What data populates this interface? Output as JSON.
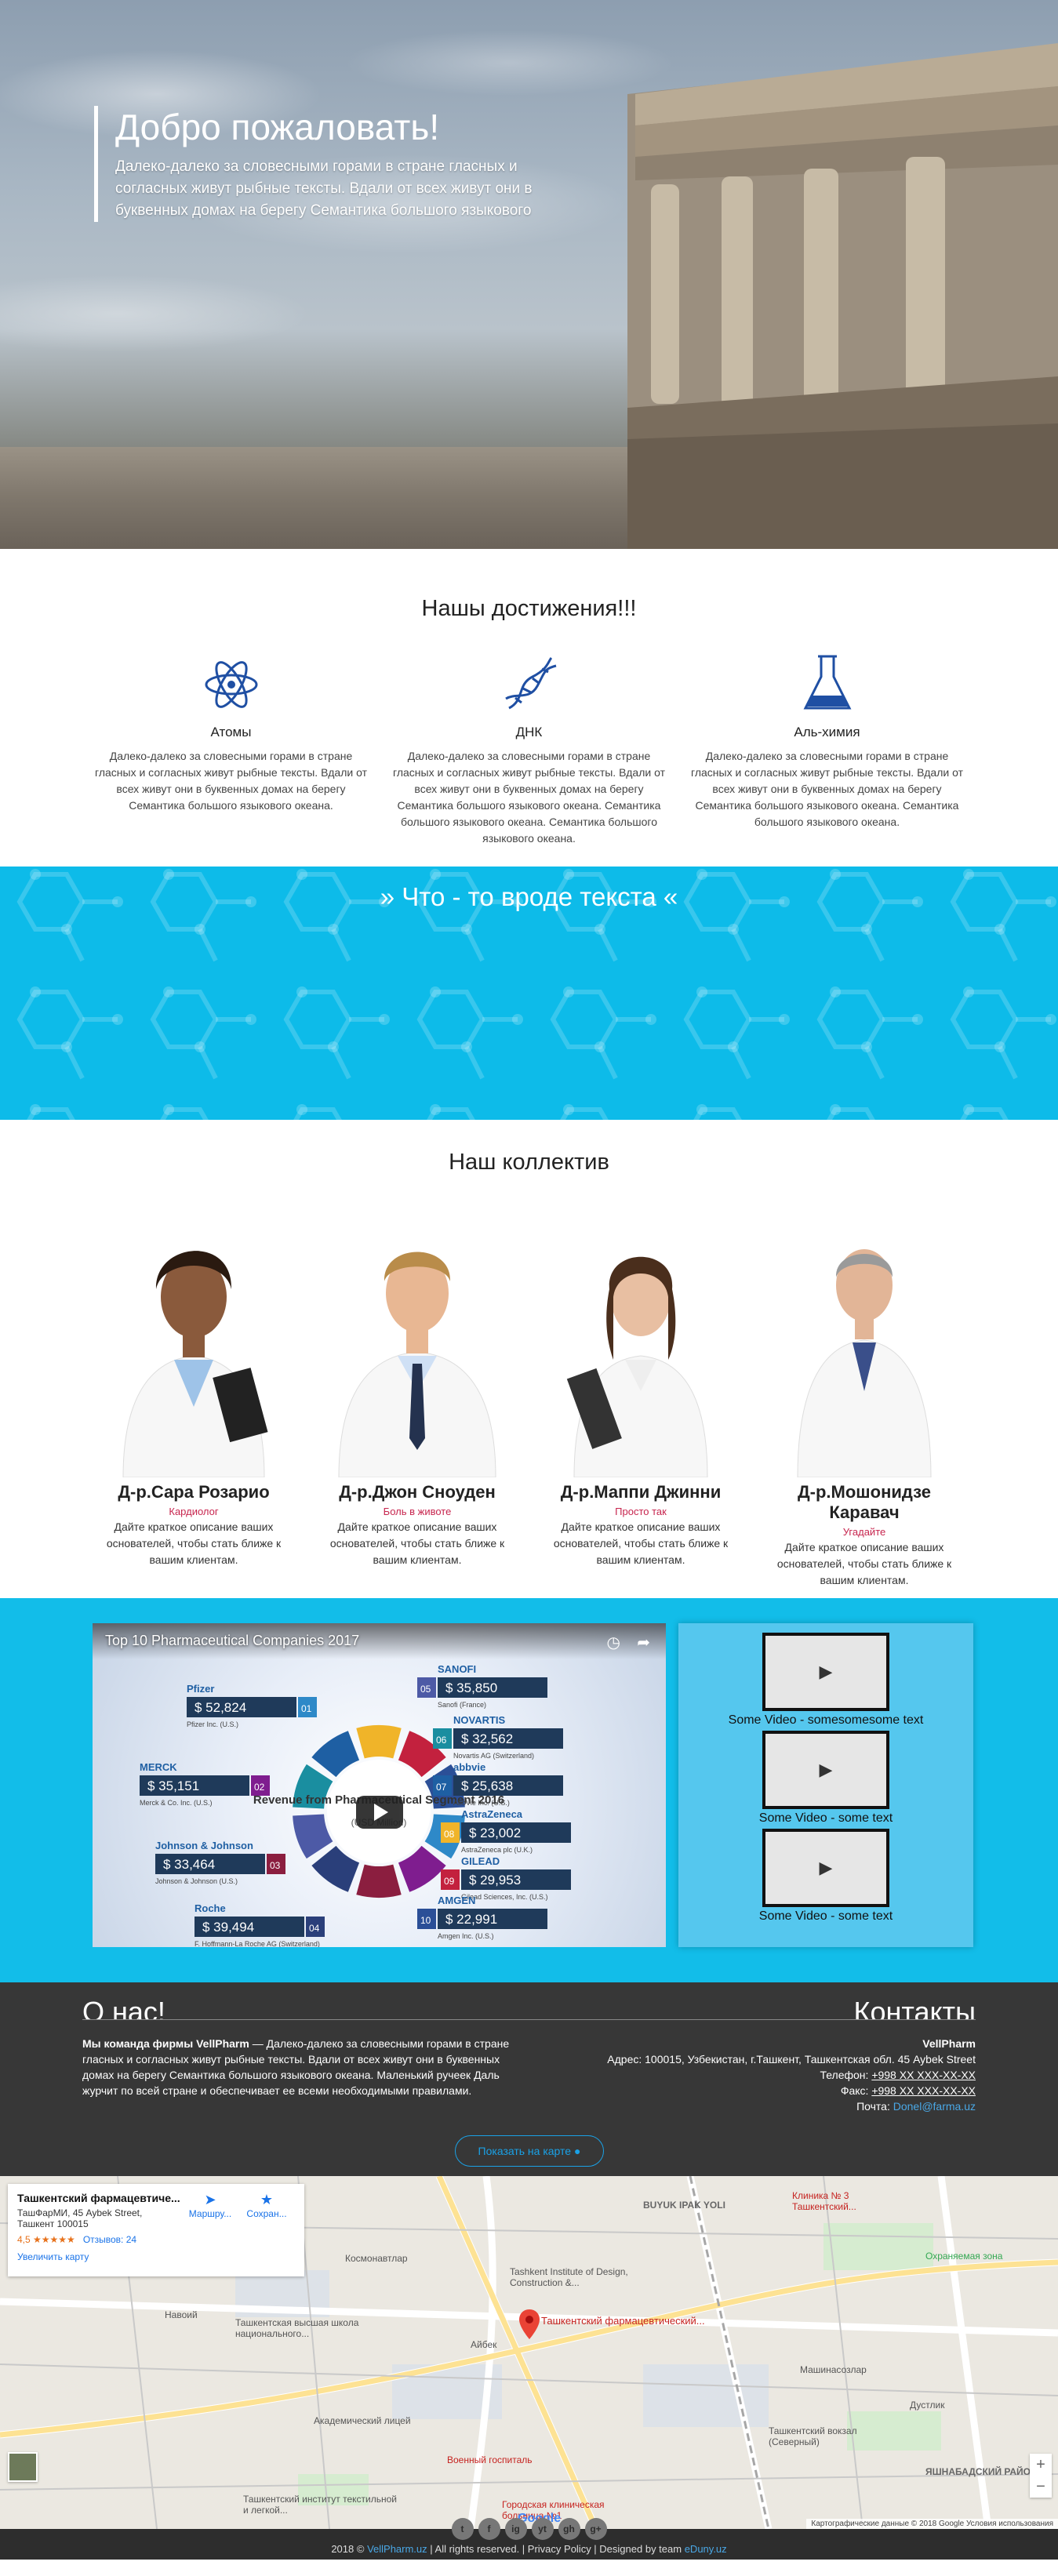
{
  "hero": {
    "title": "Добро пожаловать!",
    "text": "Далеко-далеко за словесными горами в стране гласных и согласных живут рыбные тексты. Вдали от всех живут они в буквенных домах на берегу Семантика большого языкового"
  },
  "achievements": {
    "title": "Нашы достижения!!!",
    "items": [
      {
        "icon": "atom-icon",
        "title": "Атомы",
        "text": "Далеко-далеко за словесными горами в стране гласных и согласных живут рыбные тексты. Вдали от всех живут они в буквенных домах на берегу Семантика большого языкового океана."
      },
      {
        "icon": "dna-icon",
        "title": "ДНК",
        "text": "Далеко-далеко за словесными горами в стране гласных и согласных живут рыбные тексты. Вдали от всех живут они в буквенных домах на берегу Семантика большого языкового океана. Семантика большого языкового океана. Семантика большого языкового океана."
      },
      {
        "icon": "flask-icon",
        "title": "Аль-химия",
        "text": "Далеко-далеко за словесными горами в стране гласных и согласных живут рыбные тексты. Вдали от всех живут они в буквенных домах на берегу Семантика большого языкового океана. Семантика большого языкового океана."
      }
    ]
  },
  "quote": {
    "text": "» Что - то вроде текста «"
  },
  "team": {
    "title": "Наш коллектив",
    "members": [
      {
        "name": "Д-р.Сара Розарио",
        "role": "Кардиолог",
        "text": "Дайте краткое описание ваших основателей, чтобы стать ближе к вашим клиентам."
      },
      {
        "name": "Д-р.Джон Сноуден",
        "role": "Боль в животе",
        "text": "Дайте краткое описание ваших основателей, чтобы стать ближе к вашим клиентам."
      },
      {
        "name": "Д-р.Маппи Джинни",
        "role": "Просто так",
        "text": "Дайте краткое описание ваших основателей, чтобы стать ближе к вашим клиентам."
      },
      {
        "name": "Д-р.Мошонидзе Каравач",
        "role": "Угадайте",
        "text": "Дайте краткое описание ваших основателей, чтобы стать ближе к вашим клиентам."
      }
    ]
  },
  "video": {
    "main_title": "Top 10 Pharmaceutical Companies 2017",
    "center_title": "Revenue from Pharmaceutical Segment 2016",
    "center_sub": "(USD Million)",
    "companies": [
      {
        "rank": "01",
        "brand": "Pfizer",
        "value": "$ 52,824",
        "sub": "Pfizer Inc. (U.S.)"
      },
      {
        "rank": "02",
        "brand": "MERCK",
        "value": "$ 35,151",
        "sub": "Merck & Co. Inc. (U.S.)"
      },
      {
        "rank": "03",
        "brand": "Johnson & Johnson",
        "value": "$ 33,464",
        "sub": "Johnson & Johnson (U.S.)"
      },
      {
        "rank": "04",
        "brand": "Roche",
        "value": "$ 39,494",
        "sub": "F. Hoffmann-La Roche AG (Switzerland)"
      },
      {
        "rank": "05",
        "brand": "SANOFI",
        "value": "$ 35,850",
        "sub": "Sanofi (France)"
      },
      {
        "rank": "06",
        "brand": "NOVARTIS",
        "value": "$ 32,562",
        "sub": "Novartis AG (Switzerland)"
      },
      {
        "rank": "07",
        "brand": "abbvie",
        "value": "$ 25,638",
        "sub": "AbbVie Inc. (U.S.)"
      },
      {
        "rank": "08",
        "brand": "AstraZeneca",
        "value": "$ 23,002",
        "sub": "AstraZeneca plc (U.K.)"
      },
      {
        "rank": "09",
        "brand": "GILEAD",
        "value": "$ 29,953",
        "sub": "Gilead Sciences, Inc. (U.S.)"
      },
      {
        "rank": "10",
        "brand": "AMGEN",
        "value": "$ 22,991",
        "sub": "Amgen Inc. (U.S.)"
      }
    ],
    "side": [
      {
        "caption": "Some Video - somesomesome text"
      },
      {
        "caption": "Some Video - some text"
      },
      {
        "caption": "Some Video - some text"
      }
    ]
  },
  "about": {
    "heading_left": "О нас!",
    "heading_right": "Контакты",
    "lead": "Мы команда фирмы VellPharm",
    "text": " — Далеко-далеко за словесными горами в стране гласных и согласных живут рыбные тексты. Вдали от всех живут они в буквенных домах на берегу Семантика большого языкового океана. Маленький ручеек Даль журчит по всей стране и обеспечивает ее всеми необходимыми правилами.",
    "company": "VellPharm",
    "address": "Адрес: 100015, Узбекистан, г.Ташкент, Ташкентская обл. 45 Aybek Street",
    "phone_label": "Телефон: ",
    "phone": "+998 XX XXX-XX-XX",
    "fax_label": "Факс: ",
    "fax": "+998 XX XXX-XX-XX",
    "mail_label": "Почта: ",
    "mail": "Donel@farma.uz",
    "map_button": "Показать на карте"
  },
  "map": {
    "place": "Ташкентский фармацевтиче...",
    "addr1": "ТашФарМИ, 45 Aybek Street,",
    "addr2": "Ташкент 100015",
    "rating": "4,5 ★★★★★",
    "reviews": "Отзывов: 24",
    "route": "Маршру...",
    "save": "Сохран...",
    "bigger": "Увеличить карту",
    "pin_label": "Ташкентский фармацевтический...",
    "labels": [
      {
        "text": "Космонавтлар"
      },
      {
        "text": "Tashkent Institute of Design, Construction &..."
      },
      {
        "text": "Айбек"
      },
      {
        "text": "Ташкентская высшая школа национального..."
      },
      {
        "text": "Академический лицей"
      },
      {
        "text": "Военный госпиталь"
      },
      {
        "text": "Ташкентский институт текстильной и легкой..."
      },
      {
        "text": "Городская клиническая больница №1"
      },
      {
        "text": "Ташкентский вокзал (Северный)"
      },
      {
        "text": "Машинасозлар"
      },
      {
        "text": "Дустлик"
      },
      {
        "text": "Охраняемая зона"
      },
      {
        "text": "Клиника № 3 Ташкентский..."
      },
      {
        "text": "BUYUK IPAK YOLI"
      },
      {
        "text": "Навоий"
      },
      {
        "text": "ЯШНАБАДСКИЙ РАЙОН"
      }
    ],
    "google": "Google",
    "copyright": "Картографические данные © 2018 Google   Условия использования"
  },
  "footer": {
    "prefix": "2018 © ",
    "site": "VellPharm.uz",
    "middle": " | All rights reserved. | Privacy Policy | Designed by team ",
    "team": "eDuny.uz",
    "social": [
      "t",
      "f",
      "ig",
      "yt",
      "gh",
      "g+"
    ]
  }
}
